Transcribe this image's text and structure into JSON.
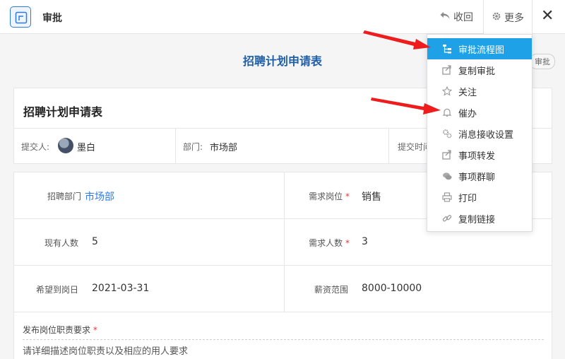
{
  "header": {
    "title": "审批",
    "collapse_label": "收回",
    "more_label": "更多",
    "close_glyph": "✕"
  },
  "form": {
    "title": "招聘计划申请表",
    "badge": "审批",
    "section_title": "招聘计划申请表",
    "submitter_label": "提交人:",
    "submitter_name": "墨白",
    "dept_label": "部门:",
    "dept_value": "市场部",
    "submit_time_label": "提交时间"
  },
  "fields": [
    {
      "label": "招聘部门",
      "value": "市场部",
      "required": false
    },
    {
      "label": "需求岗位",
      "value": "销售",
      "required": true
    },
    {
      "label": "现有人数",
      "value": "5",
      "required": false
    },
    {
      "label": "需求人数",
      "value": "3",
      "required": true
    },
    {
      "label": "希望到岗日",
      "value": "2021-03-31",
      "required": false
    },
    {
      "label": "薪资范围",
      "value": "8000-10000",
      "required": false
    }
  ],
  "description": {
    "label": "发布岗位职责要求",
    "required_mark": "*",
    "placeholder": "请详细描述岗位职责以及相应的用人要求"
  },
  "required_mark": "*",
  "menu": {
    "items": [
      {
        "label": "审批流程图",
        "icon": "flowchart-icon",
        "active": true
      },
      {
        "label": "复制审批",
        "icon": "share-icon",
        "active": false
      },
      {
        "label": "关注",
        "icon": "star-icon",
        "active": false
      },
      {
        "label": "催办",
        "icon": "bell-icon",
        "active": false
      },
      {
        "label": "消息接收设置",
        "icon": "gears-icon",
        "active": false
      },
      {
        "label": "事项转发",
        "icon": "forward-icon",
        "active": false
      },
      {
        "label": "事项群聊",
        "icon": "chat-icon",
        "active": false
      },
      {
        "label": "打印",
        "icon": "print-icon",
        "active": false
      },
      {
        "label": "复制链接",
        "icon": "link-icon",
        "active": false
      }
    ]
  },
  "colors": {
    "accent": "#1ea1e6",
    "title_blue": "#1f5fa8",
    "link_blue": "#2d7be0",
    "required_red": "#e03a3a",
    "arrow_red": "#ee1c1c"
  }
}
